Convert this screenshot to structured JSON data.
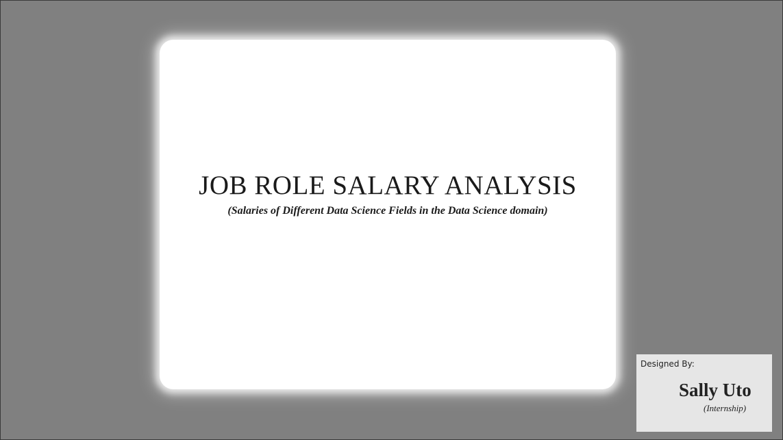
{
  "title_card": {
    "title": "JOB ROLE SALARY ANALYSIS",
    "subtitle": "(Salaries of Different Data Science Fields in the Data Science domain)"
  },
  "designer": {
    "label": "Designed By:",
    "name": "Sally Uto",
    "role": "(Internship)"
  },
  "colors": {
    "background": "#808080",
    "card": "#ffffff",
    "designer_box": "#e6e6e6",
    "text": "#1a1a1a"
  }
}
